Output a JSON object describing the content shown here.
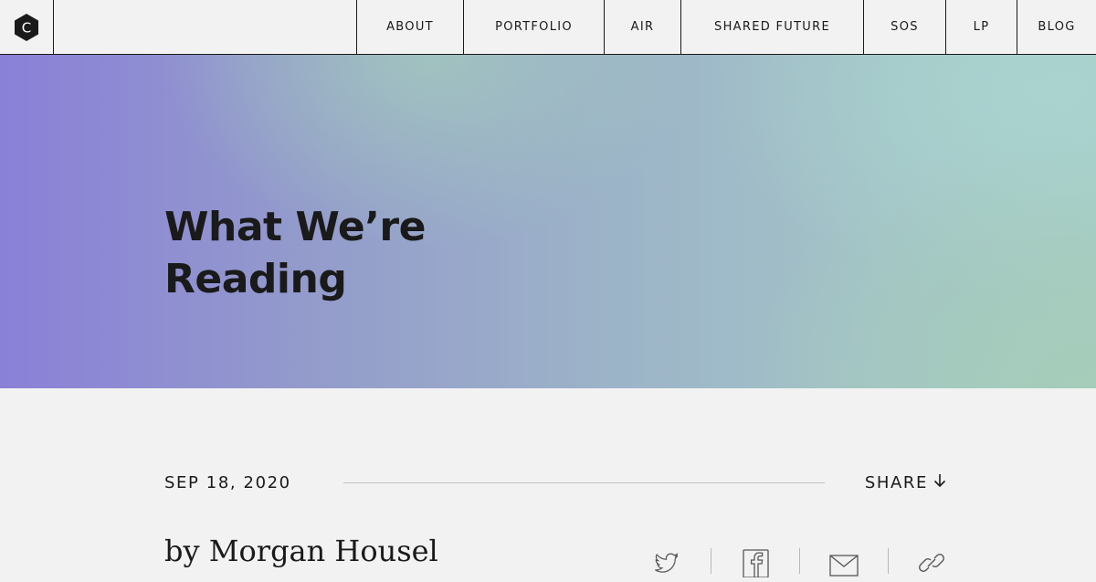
{
  "brand": {
    "logo_letter": "C",
    "logo_icon": "hexagon-logo-icon"
  },
  "nav": {
    "items": [
      {
        "label": "ABOUT"
      },
      {
        "label": "PORTFOLIO"
      },
      {
        "label": "AIR"
      },
      {
        "label": "SHARED FUTURE"
      },
      {
        "label": "SOS"
      },
      {
        "label": "LP"
      },
      {
        "label": "BLOG"
      }
    ]
  },
  "hero": {
    "title_line1": "What We’re",
    "title_line2": "Reading"
  },
  "article": {
    "date": "SEP 18, 2020",
    "share_label": "SHARE",
    "share_icon": "arrow-down-icon",
    "byline": "by Morgan Housel"
  },
  "social": {
    "icons": [
      "twitter-icon",
      "facebook-icon",
      "email-icon",
      "link-icon"
    ]
  },
  "colors": {
    "text": "#1a1a1a",
    "background": "#f2f2f2",
    "hero_purple": "#8a80d8",
    "hero_teal": "#a6cac5"
  }
}
